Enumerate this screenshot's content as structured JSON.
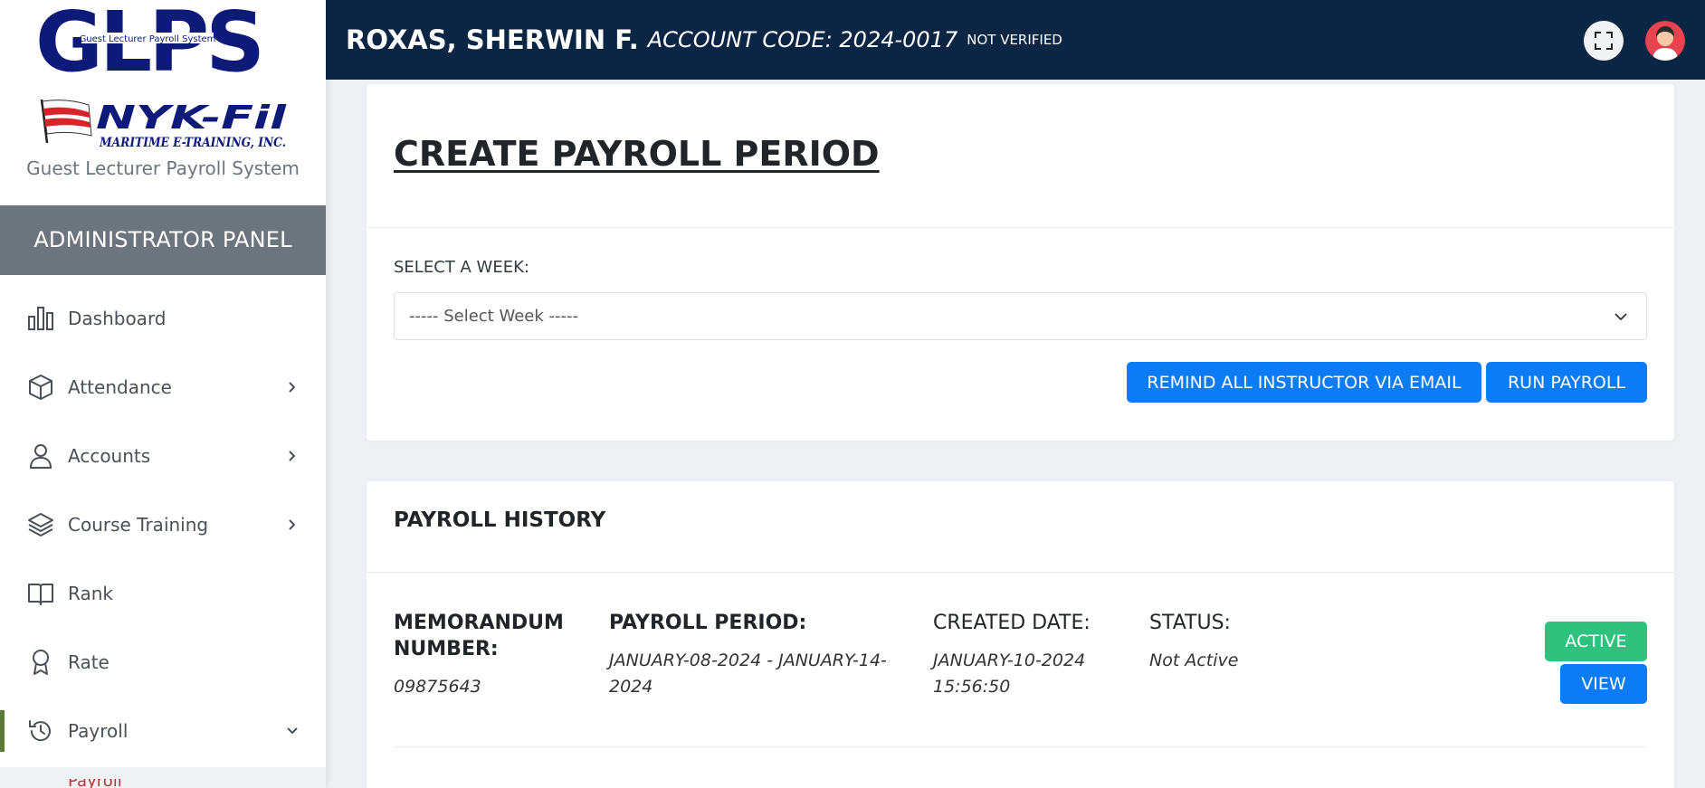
{
  "brand": {
    "logo_text": "GLPS",
    "logo_tagline": "Guest Lecturer Payroll System",
    "partner_name": "NYK-Fil",
    "partner_sub": "MARITIME E-TRAINING, INC.",
    "system_name": "Guest Lecturer Payroll System"
  },
  "sidebar": {
    "panel_title": "ADMINISTRATOR PANEL",
    "items": [
      {
        "label": "Dashboard",
        "icon": "bar-chart-icon",
        "has_children": false
      },
      {
        "label": "Attendance",
        "icon": "box-icon",
        "has_children": true
      },
      {
        "label": "Accounts",
        "icon": "user-icon",
        "has_children": true
      },
      {
        "label": "Course Training",
        "icon": "layers-icon",
        "has_children": true
      },
      {
        "label": "Rank",
        "icon": "book-icon",
        "has_children": false
      },
      {
        "label": "Rate",
        "icon": "award-icon",
        "has_children": false
      },
      {
        "label": "Payroll",
        "icon": "history-icon",
        "has_children": true,
        "expanded": true
      }
    ],
    "submenu_peek": "Payroll Period"
  },
  "topbar": {
    "user_name": "ROXAS, SHERWIN F.",
    "account_code": "ACCOUNT CODE: 2024-0017",
    "verification": "NOT VERIFIED"
  },
  "create_card": {
    "title": "CREATE PAYROLL PERIOD",
    "select_label": "SELECT A WEEK:",
    "select_value": "----- Select Week -----",
    "remind_button": "REMIND ALL INSTRUCTOR VIA EMAIL",
    "run_button": "RUN PAYROLL"
  },
  "history": {
    "title": "PAYROLL HISTORY",
    "headers": {
      "memo": "MEMORANDUM NUMBER:",
      "period": "PAYROLL PERIOD:",
      "created": "CREATED DATE:",
      "status": "STATUS:"
    },
    "rows": [
      {
        "memo": "09875643",
        "period": "JANUARY-08-2024 - JANUARY-14-2024",
        "created": "JANUARY-10-2024 15:56:50",
        "status": "Not Active",
        "active_button": "ACTIVE",
        "view_button": "VIEW"
      }
    ]
  },
  "colors": {
    "topbar": "#0b2545",
    "primary": "#0b7cf5",
    "success": "#2ec27e",
    "panel": "#6c757d"
  }
}
